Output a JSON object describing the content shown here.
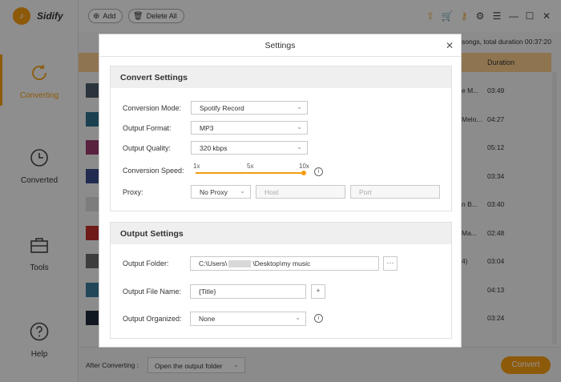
{
  "app": {
    "name": "Sidify"
  },
  "sidebar": {
    "items": [
      {
        "label": "Converting",
        "icon": "refresh-icon",
        "active": true
      },
      {
        "label": "Converted",
        "icon": "clock-icon",
        "active": false
      },
      {
        "label": "Tools",
        "icon": "toolbox-icon",
        "active": false
      },
      {
        "label": "Help",
        "icon": "help-icon",
        "active": false
      }
    ]
  },
  "toolbar": {
    "add_label": "Add",
    "delete_all_label": "Delete All",
    "icons": [
      "upload-icon",
      "cart-icon",
      "key-icon",
      "gear-icon",
      "menu-icon",
      "minimize-icon",
      "maximize-icon",
      "close-icon"
    ]
  },
  "summary": {
    "text": "songs, total duration 00:37:20"
  },
  "table": {
    "duration_header": "Duration",
    "rows": [
      {
        "text": "e M...",
        "duration": "03:49",
        "color": "#4a5a6a"
      },
      {
        "text": "Melo...",
        "duration": "04:27",
        "color": "#2f6f8a"
      },
      {
        "text": "",
        "duration": "05:12",
        "color": "#9a3a6a"
      },
      {
        "text": "",
        "duration": "03:34",
        "color": "#3a4a8a"
      },
      {
        "text": "n B...",
        "duration": "03:40",
        "color": "#d8d8d8"
      },
      {
        "text": "Ma...",
        "duration": "02:48",
        "color": "#c0302a"
      },
      {
        "text": "4)",
        "duration": "03:04",
        "color": "#6a6a6a"
      },
      {
        "text": "",
        "duration": "04:13",
        "color": "#3a7a9a"
      },
      {
        "text": "",
        "duration": "03:24",
        "color": "#202a3a"
      }
    ]
  },
  "footer": {
    "after_label": "After Converting :",
    "after_value": "Open the output folder",
    "convert_label": "Convert"
  },
  "dialog": {
    "title": "Settings",
    "convert_section": {
      "title": "Convert Settings",
      "mode_label": "Conversion Mode:",
      "mode_value": "Spotify Record",
      "format_label": "Output Format:",
      "format_value": "MP3",
      "quality_label": "Output Quality:",
      "quality_value": "320 kbps",
      "speed_label": "Conversion Speed:",
      "speed_ticks": [
        "1x",
        "5x",
        "10x"
      ],
      "speed_value": "10x",
      "proxy_label": "Proxy:",
      "proxy_value": "No Proxy",
      "host_placeholder": "Host",
      "port_placeholder": "Port"
    },
    "output_section": {
      "title": "Output Settings",
      "folder_label": "Output Folder:",
      "folder_prefix": "C:\\Users\\",
      "folder_suffix": "\\Desktop\\my music",
      "browse_label": "···",
      "filename_label": "Output File Name:",
      "filename_value": "{Title}",
      "add_label": "+",
      "organized_label": "Output Organized:",
      "organized_value": "None"
    }
  },
  "colors": {
    "accent": "#f39c12",
    "header_row": "#f6c98a"
  }
}
